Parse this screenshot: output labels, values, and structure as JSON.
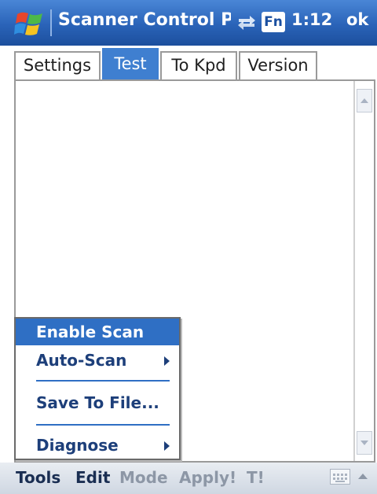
{
  "titlebar": {
    "title": "Scanner Control Pa",
    "fn_label": "Fn",
    "time": "1:12",
    "ok_label": "ok"
  },
  "tabs": [
    {
      "label": "Settings"
    },
    {
      "label": "Test",
      "active": true
    },
    {
      "label": "To Kpd"
    },
    {
      "label": "Version"
    }
  ],
  "context_menu": {
    "items": [
      {
        "label": "Enable Scan",
        "selected": true
      },
      {
        "label": "Auto-Scan",
        "submenu": true
      },
      {
        "label": "Save To File..."
      },
      {
        "label": "Diagnose",
        "submenu": true
      }
    ]
  },
  "menubar": {
    "items": [
      {
        "label": "Tools",
        "enabled": true
      },
      {
        "label": "Edit",
        "enabled": true
      },
      {
        "label": "Mode",
        "enabled": false
      },
      {
        "label": "Apply!",
        "enabled": false
      },
      {
        "label": "T!",
        "enabled": false
      }
    ]
  },
  "colors": {
    "titlebar": "#2a63b8",
    "selection": "#2f6fc4",
    "menu_text": "#1d3f7a",
    "disabled_text": "#8d97a6"
  }
}
